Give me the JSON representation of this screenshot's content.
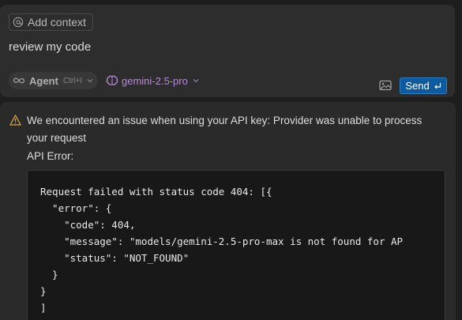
{
  "composer": {
    "context_chip": {
      "icon": "at-icon",
      "label": "Add context"
    },
    "prompt_text": "review my code",
    "agent_mode": {
      "icon": "infinity-icon",
      "label": "Agent",
      "shortcut": "Ctrl+I"
    },
    "model": {
      "icon": "brain-icon",
      "label": "gemini-2.5-pro"
    },
    "image_button": {
      "icon": "image-icon"
    },
    "send_button": {
      "label": "Send",
      "icon": "enter-icon",
      "color": "#0e5a9e"
    }
  },
  "error": {
    "icon": "warning-icon",
    "icon_color": "#d7a53c",
    "message_line1": "We encountered an issue when using your API key: Provider was unable to process",
    "message_line2": "your request",
    "label": "API Error:",
    "code": "Request failed with status code 404: [{\n  \"error\": {\n    \"code\": 404,\n    \"message\": \"models/gemini-2.5-pro-max is not found for AP\n    \"status\": \"NOT_FOUND\"\n  }\n}\n]"
  }
}
